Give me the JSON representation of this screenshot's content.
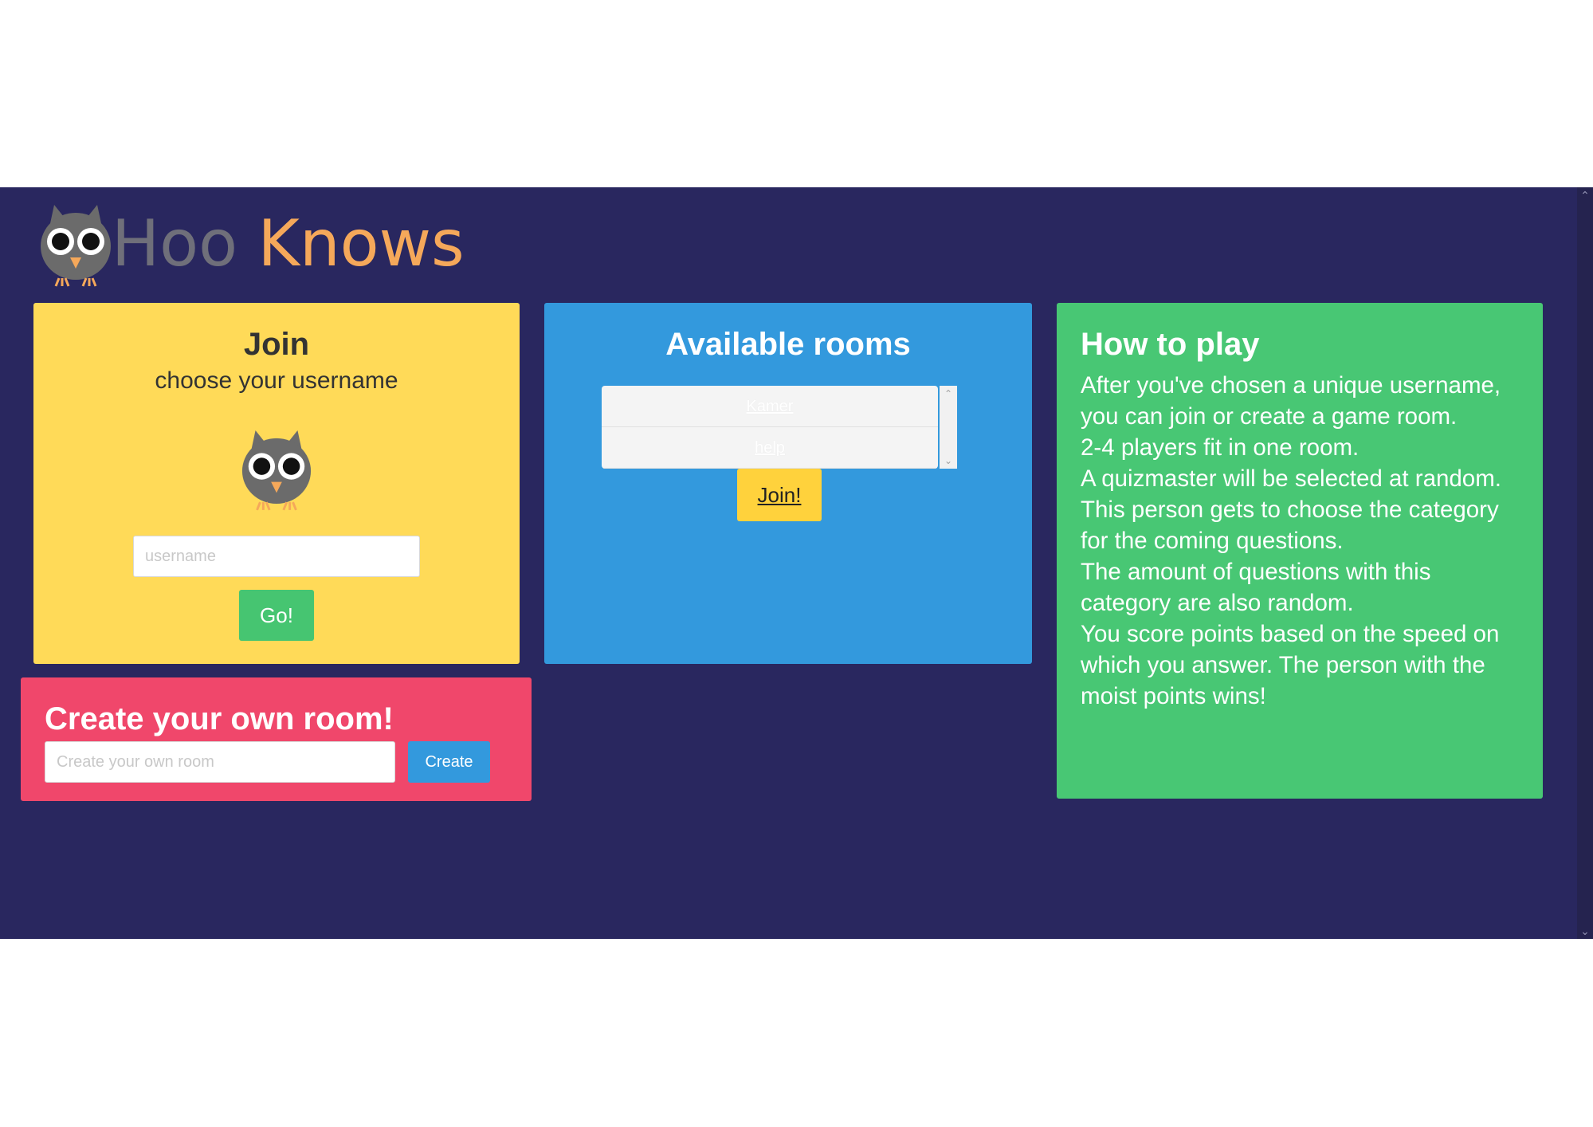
{
  "header": {
    "title_part1": "Hoo",
    "title_part2": "Knows",
    "logo_icon": "owl-icon"
  },
  "join": {
    "title": "Join",
    "subtitle": "choose your username",
    "username_placeholder": "username",
    "username_value": "",
    "go_label": "Go!"
  },
  "rooms": {
    "title": "Available rooms",
    "items": [
      "Kamer",
      "help"
    ],
    "join_label": "Join!"
  },
  "howto": {
    "title": "How to play",
    "lines": [
      "After you've chosen a unique username, you can join or create a game room.",
      "2-4 players fit in one room.",
      "A quizmaster will be selected at random. This person gets to choose the category for the coming questions.",
      "The amount of questions with this category are also random.",
      "You score points based on the speed on which you answer. The person with the moist points wins!"
    ]
  },
  "create": {
    "title": "Create your own room!",
    "input_placeholder": "Create your own room",
    "input_value": "",
    "button_label": "Create"
  },
  "colors": {
    "page_background": "#29275f",
    "join_card": "#ffda58",
    "rooms_card": "#3399dd",
    "howto_card": "#48c774",
    "create_card": "#f0476b",
    "title_gray": "#6f6f7a",
    "title_orange": "#f5a85a"
  }
}
